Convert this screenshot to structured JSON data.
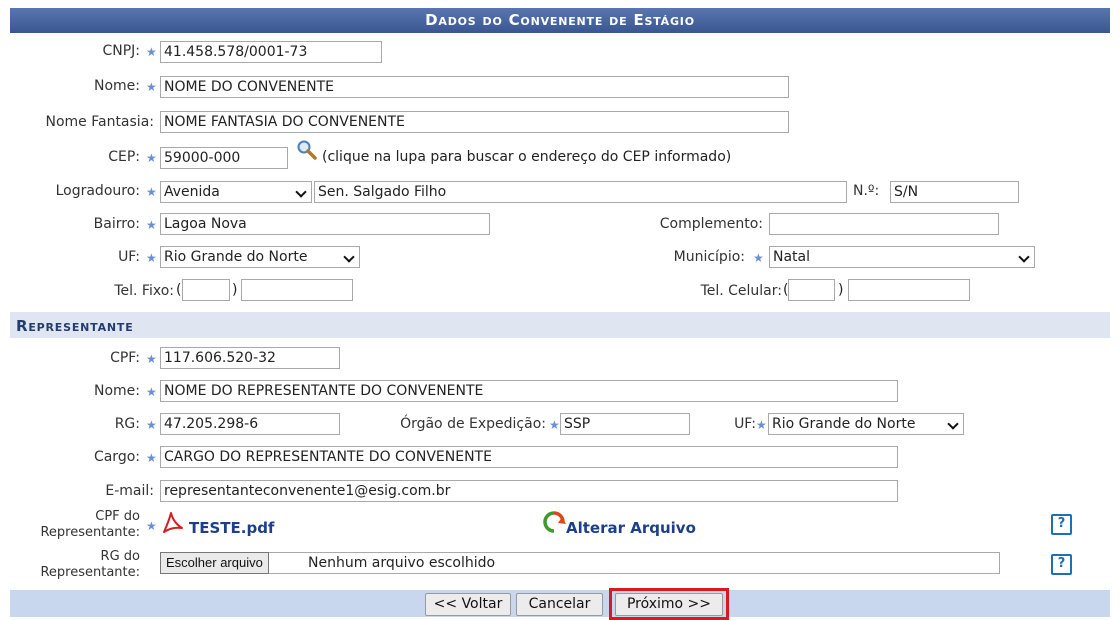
{
  "title": "Dados do Convenente de Estágio",
  "convenente": {
    "cnpj_label": "CNPJ:",
    "cnpj": "41.458.578/0001-73",
    "nome_label": "Nome:",
    "nome": "NOME DO CONVENENTE",
    "fantasia_label": "Nome Fantasia:",
    "fantasia": "NOME FANTASIA DO CONVENENTE",
    "cep_label": "CEP:",
    "cep": "59000-000",
    "cep_hint": "(clique na lupa para buscar o endereço do CEP informado)",
    "logradouro_label": "Logradouro:",
    "logradouro_tipo": "Avenida",
    "logradouro": "Sen. Salgado Filho",
    "numero_label": "N.º:",
    "numero": "S/N",
    "bairro_label": "Bairro:",
    "bairro": "Lagoa Nova",
    "complemento_label": "Complemento:",
    "complemento": "",
    "uf_label": "UF:",
    "uf": "Rio Grande do Norte",
    "municipio_label": "Município:",
    "municipio": "Natal",
    "tel_fixo_label": "Tel. Fixo:",
    "tel_celular_label": "Tel. Celular:",
    "paren_open": "(",
    "paren_close": ")"
  },
  "representante": {
    "section_title": "Representante",
    "cpf_label": "CPF:",
    "cpf": "117.606.520-32",
    "nome_label": "Nome:",
    "nome": "NOME DO REPRESENTANTE DO CONVENENTE",
    "rg_label": "RG:",
    "rg": "47.205.298-6",
    "orgao_label": "Órgão de Expedição:",
    "orgao": "SSP",
    "uf_label": "UF:",
    "uf": "Rio Grande do Norte",
    "cargo_label": "Cargo:",
    "cargo": "CARGO DO REPRESENTANTE DO CONVENENTE",
    "email_label": "E-mail:",
    "email": "representanteconvenente1@esig.com.br",
    "cpf_doc_label_1": "CPF do",
    "cpf_doc_label_2": "Representante:",
    "cpf_doc_file": "TESTE.pdf",
    "alterar_arquivo": "Alterar Arquivo",
    "rg_doc_label_1": "RG do",
    "rg_doc_label_2": "Representante:",
    "escolher_arquivo": "Escolher arquivo",
    "nenhum_arquivo": "Nenhum arquivo escolhido"
  },
  "actions": {
    "voltar": "<< Voltar",
    "cancelar": "Cancelar",
    "proximo": "Próximo >>"
  },
  "required_marker": "★",
  "help_icon_text": "?",
  "colors": {
    "title_bar": "#3a5690",
    "section_bg": "#dfe6f2",
    "footer_bg": "#c9d7ee",
    "highlight": "#d9191f",
    "link": "#1d3f8a"
  }
}
